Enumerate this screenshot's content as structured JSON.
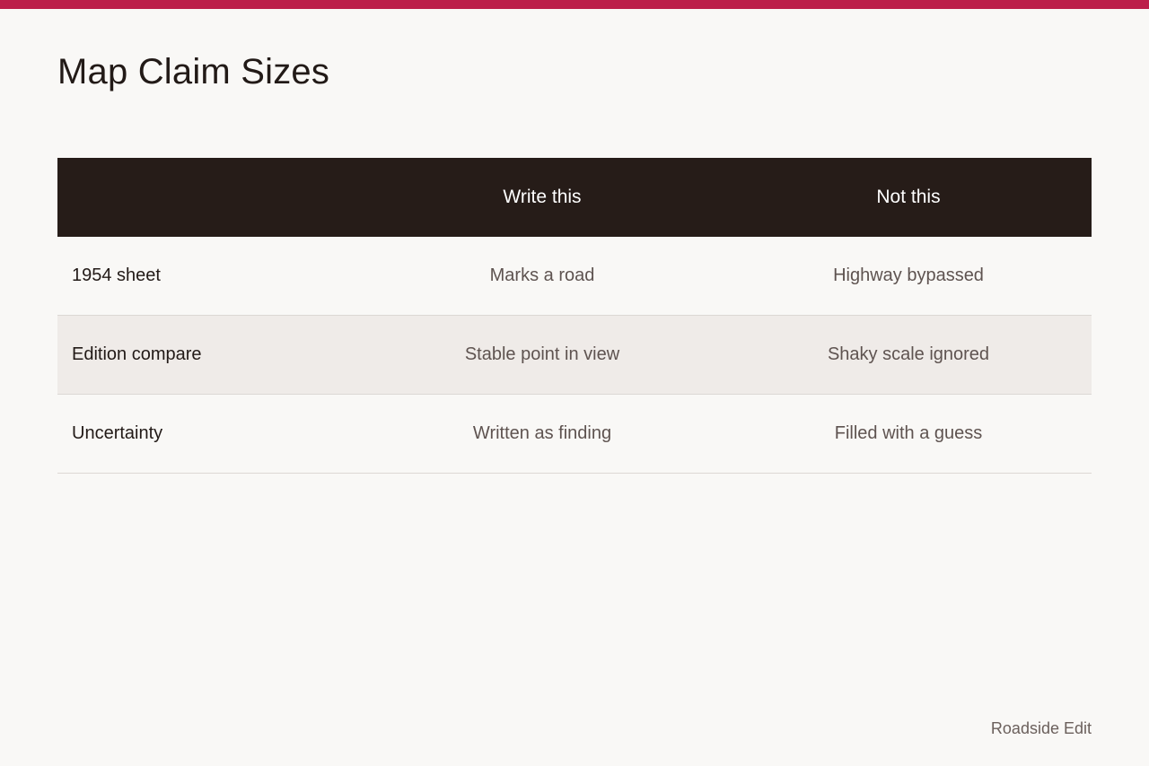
{
  "page": {
    "title": "Map Claim Sizes",
    "accent_color": "#bc1f4a",
    "header_bg": "#261c18"
  },
  "table": {
    "headers": [
      "",
      "Write this",
      "Not this"
    ],
    "rows": [
      {
        "label": "1954 sheet",
        "write": "Marks a road",
        "not": "Highway bypassed"
      },
      {
        "label": "Edition compare",
        "write": "Stable point in view",
        "not": "Shaky scale ignored"
      },
      {
        "label": "Uncertainty",
        "write": "Written as finding",
        "not": "Filled with a guess"
      }
    ]
  },
  "footer": {
    "brand": "Roadside Edit"
  }
}
